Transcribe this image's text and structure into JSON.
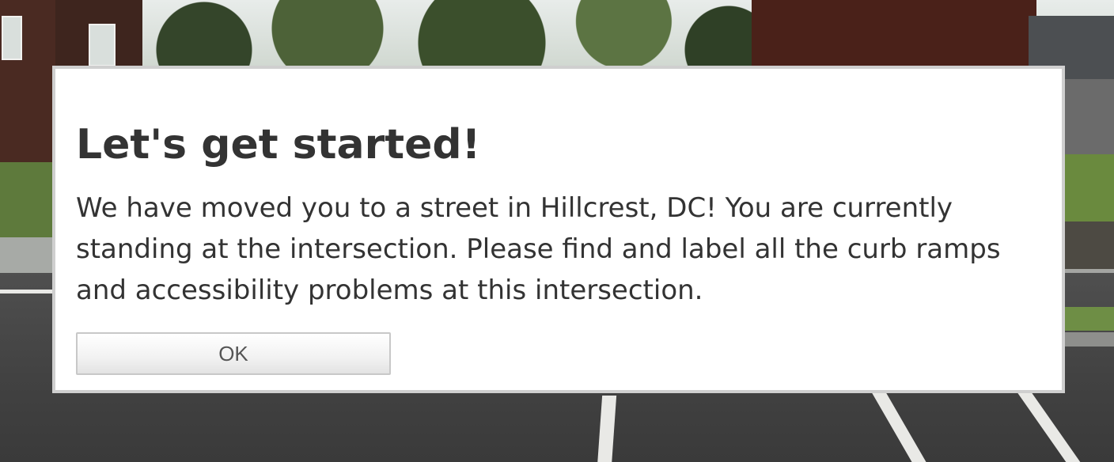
{
  "dialog": {
    "title": "Let's get started!",
    "body": "We have moved you to a street in Hillcrest, DC! You are currently standing at the intersection. Please find and label all the curb ramps and accessibility problems at this intersection.",
    "ok_label": "OK"
  },
  "colors": {
    "dialog_background": "#ffffff",
    "dialog_border": "#cfcfcf",
    "text": "#333333",
    "button_text": "#555555"
  }
}
